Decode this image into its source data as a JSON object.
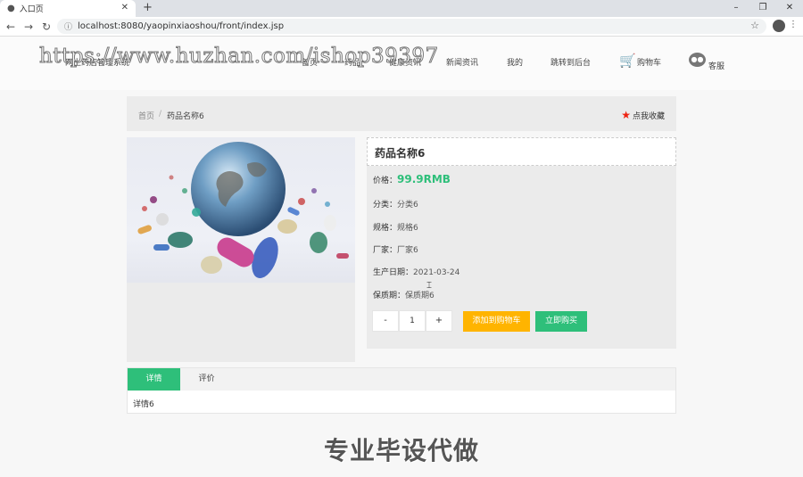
{
  "browser": {
    "tab_title": "入口页",
    "url": "localhost:8080/yaopinxiaoshou/front/index.jsp"
  },
  "watermark": "https://www.huzhan.com/ishop39397",
  "nav": {
    "brand": "网上药店管理系统",
    "links": [
      "首页",
      "药品",
      "健康资讯",
      "新闻资讯",
      "我的",
      "跳转到后台",
      "购物车",
      "客服"
    ]
  },
  "breadcrumb": {
    "home": "首页",
    "separator": "/",
    "current": "药品名称6",
    "favorite": "点我收藏"
  },
  "product": {
    "name": "药品名称6",
    "price_label": "价格：",
    "price": "99.9RMB",
    "fields": [
      {
        "label": "分类：",
        "value": "分类6"
      },
      {
        "label": "规格：",
        "value": "规格6"
      },
      {
        "label": "厂家：",
        "value": "厂家6"
      },
      {
        "label": "生产日期：",
        "value": "2021-03-24"
      },
      {
        "label": "保质期：",
        "value": "保质期6"
      }
    ],
    "qty_minus": "-",
    "qty": "1",
    "qty_plus": "+",
    "add_cart": "添加到购物车",
    "buy_now": "立即购买"
  },
  "tabs": {
    "detail": "详情",
    "review": "评价",
    "content": "详情6"
  },
  "footer_watermark": "专业毕设代做",
  "colors": {
    "accent_green": "#2ebf7a",
    "accent_orange": "#ffb400",
    "favorite_star": "#e21"
  }
}
